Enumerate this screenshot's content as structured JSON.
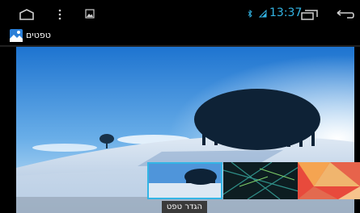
{
  "statusbar": {
    "clock": "13:37",
    "nav_icons": [
      "home-icon",
      "menu-dots-icon",
      "image-icon",
      "recents-icon",
      "back-icon"
    ],
    "status_icons": [
      "bluetooth-icon",
      "signal-icon"
    ],
    "accent_color": "#33b5e5"
  },
  "app": {
    "title": "טפטים",
    "app_icon": "wallpaper-app-icon"
  },
  "thumbnails": [
    {
      "name": "winter-trees",
      "selected": true
    },
    {
      "name": "teal-lines",
      "selected": false
    },
    {
      "name": "geometric-red",
      "selected": false
    }
  ],
  "action": {
    "set_wallpaper_label": "הגדר טפט"
  }
}
